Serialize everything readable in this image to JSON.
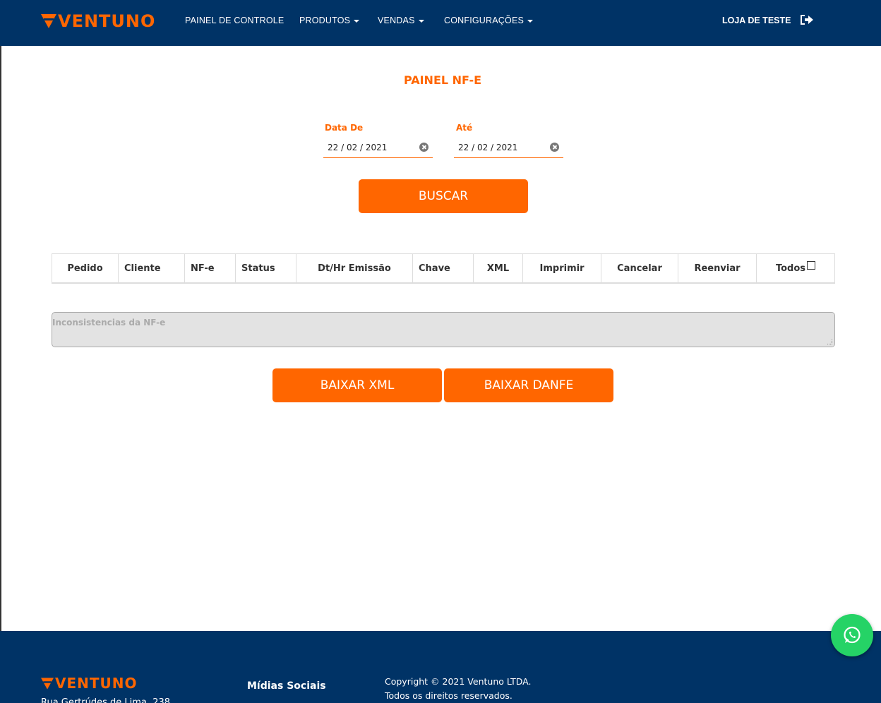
{
  "brand": {
    "name": "VENTUNO",
    "color": "#ff6600",
    "navy": "#003366"
  },
  "nav": {
    "items": [
      {
        "label": "PAINEL DE CONTROLE",
        "dropdown": false
      },
      {
        "label": "PRODUTOS",
        "dropdown": true
      },
      {
        "label": "VENDAS",
        "dropdown": true
      },
      {
        "label": "CONFIGURAÇÕES",
        "dropdown": true
      }
    ],
    "store_label": "LOJA DE TESTE",
    "logout_icon": "sign-out-icon"
  },
  "page": {
    "title": "PAINEL NF-E",
    "date_from": {
      "label": "Data De",
      "value": "22 / 02 / 2021"
    },
    "date_to": {
      "label": "Até",
      "value": "22 / 02 / 2021"
    },
    "search_button": "BUSCAR"
  },
  "table": {
    "columns": [
      "Pedido",
      "Cliente",
      "NF-e",
      "Status",
      "Dt/Hr Emissão",
      "Chave",
      "XML",
      "Imprimir",
      "Cancelar",
      "Reenviar",
      "Todos"
    ],
    "rows": []
  },
  "inconsistencies": {
    "placeholder": "Inconsistencias da NF-e"
  },
  "actions": {
    "download_xml": "BAIXAR XML",
    "download_danfe": "BAIXAR DANFE"
  },
  "footer": {
    "logo": "VENTUNO",
    "address": "Rua Gertrúdes de Lima, 238",
    "social_title": "Mídias Sociais",
    "copyright_line1": "Copyright © 2021 Ventuno LTDA.",
    "copyright_line2": "Todos os direitos reservados."
  },
  "floating": {
    "icon": "whatsapp-icon",
    "color": "#25d366"
  }
}
